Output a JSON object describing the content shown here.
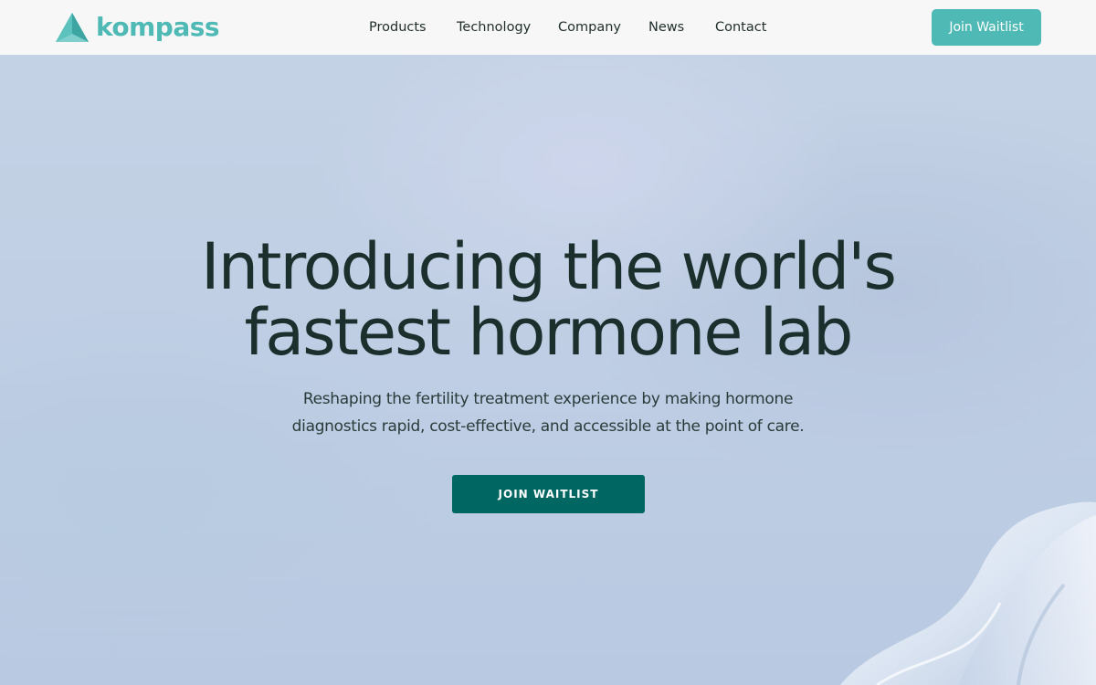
{
  "brand": {
    "name": "kompass",
    "logo_icon": "compass-triangle-logo",
    "color": "#4fb9b5"
  },
  "nav": {
    "items": [
      {
        "label": "Products"
      },
      {
        "label": "Technology"
      },
      {
        "label": "Company"
      },
      {
        "label": "News"
      },
      {
        "label": "Contact"
      }
    ],
    "cta_label": "Join Waitlist"
  },
  "hero": {
    "headline_line1": "Introducing the world's",
    "headline_line2": "fastest hormone lab",
    "subhead_line1": "Reshaping the fertility treatment experience by making hormone",
    "subhead_line2": "diagnostics rapid, cost-effective, and accessible at the point of care.",
    "cta_label": "JOIN WAITLIST"
  },
  "colors": {
    "accent": "#4fb9b5",
    "primary_button": "#006662",
    "heading_text": "#1b302d",
    "header_bg": "#f7f7f7"
  }
}
